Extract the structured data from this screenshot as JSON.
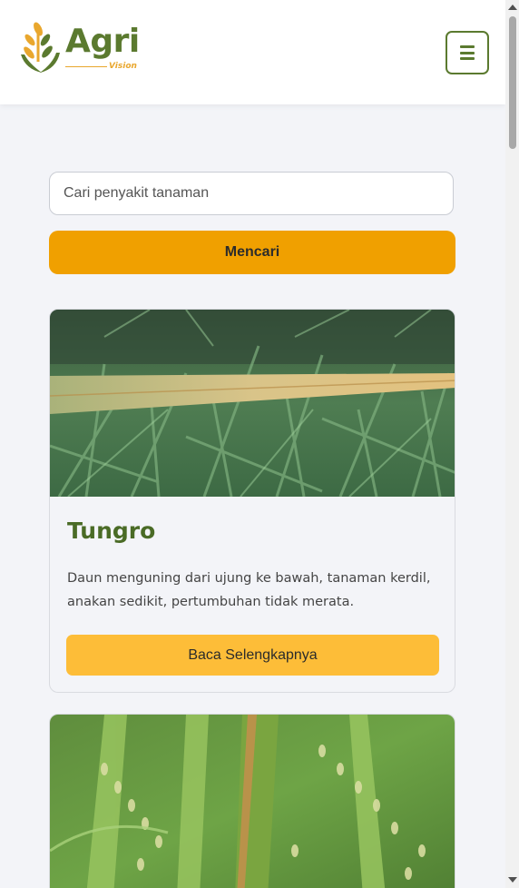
{
  "brand": {
    "name": "Agri",
    "tagline": "Vision",
    "colors": {
      "green": "#5b7a2f",
      "orange": "#e9a72e"
    }
  },
  "header": {
    "menu_icon": "hamburger-icon"
  },
  "search": {
    "placeholder": "Cari penyakit tanaman",
    "value": "",
    "button_label": "Mencari"
  },
  "cards": [
    {
      "title": "Tungro",
      "description": "Daun menguning dari ujung ke bawah, tanaman kerdil, anakan sedikit, pertumbuhan tidak merata.",
      "button_label": "Baca Selengkapnya"
    },
    {
      "title": "",
      "description": "",
      "button_label": ""
    }
  ]
}
